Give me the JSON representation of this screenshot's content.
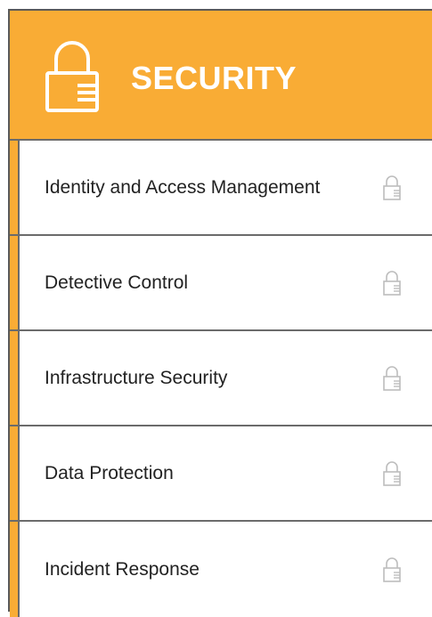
{
  "header": {
    "title": "SECURITY",
    "icon": "lock-icon"
  },
  "colors": {
    "accent": "#F9AC35",
    "divider": "#6B6B6B",
    "text": "#222222",
    "icon_muted": "#BDBDBD"
  },
  "menu": {
    "items": [
      {
        "label": "Identity and Access Management",
        "icon": "lock-icon"
      },
      {
        "label": "Detective Control",
        "icon": "lock-icon"
      },
      {
        "label": "Infrastructure Security",
        "icon": "lock-icon"
      },
      {
        "label": "Data Protection",
        "icon": "lock-icon"
      },
      {
        "label": "Incident Response",
        "icon": "lock-icon"
      }
    ]
  }
}
